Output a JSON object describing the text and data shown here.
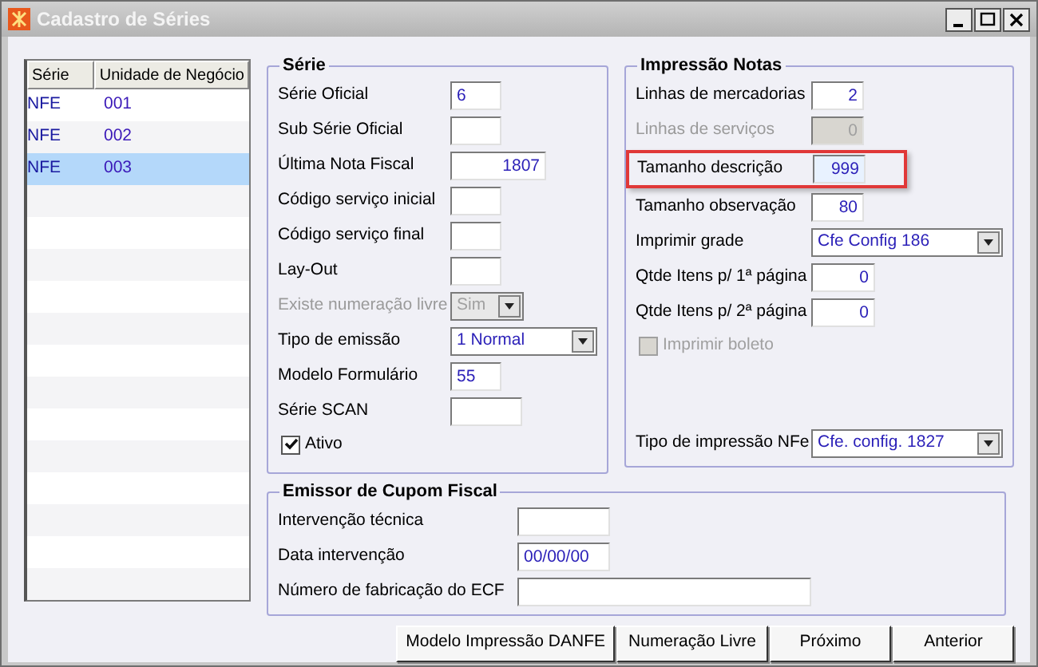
{
  "window": {
    "title": "Cadastro de Séries"
  },
  "list": {
    "columns": [
      "Série",
      "Unidade de Negócio"
    ],
    "rows": [
      {
        "cells": [
          "NFE",
          "001"
        ],
        "selected": false
      },
      {
        "cells": [
          "NFE",
          "002"
        ],
        "selected": false
      },
      {
        "cells": [
          "NFE",
          "003"
        ],
        "selected": true
      }
    ]
  },
  "serie": {
    "title": "Série",
    "fields": [
      {
        "kind": "input",
        "label": "Série Oficial",
        "value": "6",
        "disabled": false
      },
      {
        "kind": "input",
        "label": "Sub Série Oficial",
        "disabled": false
      },
      {
        "kind": "input",
        "label": "Última Nota Fiscal",
        "value": "1807",
        "disabled": false
      },
      {
        "kind": "input",
        "label": "Código serviço inicial",
        "disabled": false
      },
      {
        "kind": "input",
        "label": "Código serviço final",
        "disabled": false
      },
      {
        "kind": "input",
        "label": "Lay-Out",
        "disabled": false
      },
      {
        "kind": "combo",
        "label": "Existe numeração livre",
        "value": "Sim",
        "disabled": true
      },
      {
        "kind": "combo",
        "label": "Tipo de emissão",
        "value": "1 Normal",
        "disabled": false
      },
      {
        "kind": "input",
        "label": "Modelo Formulário",
        "value": "55",
        "disabled": false
      },
      {
        "kind": "input",
        "label": "Série SCAN",
        "disabled": false
      },
      {
        "kind": "checkbox",
        "label": "Ativo",
        "checked": true,
        "disabled": false
      }
    ]
  },
  "impressao": {
    "title": "Impressão Notas",
    "fields": [
      {
        "kind": "input",
        "label": "Linhas de mercadorias",
        "value": "2",
        "disabled": false,
        "highlighted": false
      },
      {
        "kind": "input",
        "label": "Linhas de serviços",
        "value": "0",
        "disabled": true,
        "highlighted": false
      },
      {
        "kind": "input",
        "label": "Tamanho descrição",
        "value": "999",
        "disabled": false,
        "highlighted": true
      },
      {
        "kind": "input",
        "label": "Tamanho observação",
        "value": "80",
        "disabled": false,
        "highlighted": false
      },
      {
        "kind": "combo",
        "label": "Imprimir grade",
        "value": "Cfe Config 186",
        "disabled": false,
        "highlighted": false
      },
      {
        "kind": "input",
        "label": "Qtde Itens p/ 1ª página",
        "value": "0",
        "disabled": false,
        "highlighted": false
      },
      {
        "kind": "input",
        "label": "Qtde Itens p/ 2ª página",
        "value": "0",
        "disabled": false,
        "highlighted": false
      },
      {
        "kind": "checkbox",
        "label": "Imprimir boleto",
        "checked": false,
        "disabled": true,
        "highlighted": false
      },
      {
        "kind": "combo",
        "label": "Tipo de impressão NFe",
        "value": "Cfe. config. 1827",
        "disabled": false,
        "highlighted": false
      }
    ]
  },
  "emissor": {
    "title": "Emissor de Cupom Fiscal",
    "fields": [
      {
        "kind": "input",
        "label": "Intervenção técnica"
      },
      {
        "kind": "input",
        "label": "Data intervenção",
        "value": "00/00/00"
      },
      {
        "kind": "input",
        "label": "Número de fabricação do ECF"
      }
    ]
  },
  "buttons": [
    "Modelo Impressão DANFE",
    "Numeração Livre",
    "Próximo",
    "Anterior"
  ]
}
